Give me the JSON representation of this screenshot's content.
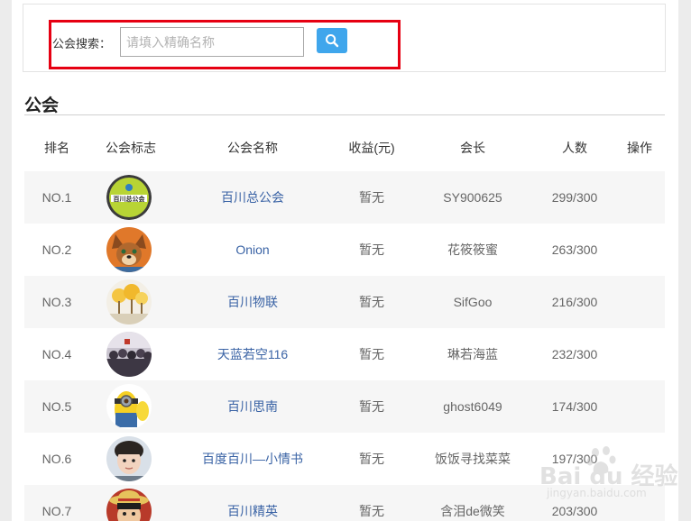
{
  "search": {
    "label": "公会搜索：",
    "placeholder": "请填入精确名称",
    "button_icon": "search-icon"
  },
  "section": {
    "title": "公会"
  },
  "table": {
    "headers": [
      "排名",
      "公会标志",
      "公会名称",
      "收益(元)",
      "会长",
      "人数",
      "操作"
    ],
    "rows": [
      {
        "rank": "NO.1",
        "logo": "guild-logo-bc",
        "logo_text": "百川总公会",
        "name": "百川总公会",
        "income": "暂无",
        "leader": "SY900625",
        "members": "299/300"
      },
      {
        "rank": "NO.2",
        "logo": "guild-logo-fox",
        "name": "Onion",
        "income": "暂无",
        "leader": "花筱筱蜜",
        "members": "263/300"
      },
      {
        "rank": "NO.3",
        "logo": "guild-logo-trees",
        "name": "百川物联",
        "income": "暂无",
        "leader": "SifGoo",
        "members": "216/300"
      },
      {
        "rank": "NO.4",
        "logo": "guild-logo-crowd",
        "name": "天蓝若空116",
        "income": "暂无",
        "leader": "琳若海蓝",
        "members": "232/300"
      },
      {
        "rank": "NO.5",
        "logo": "guild-logo-minion",
        "name": "百川思南",
        "income": "暂无",
        "leader": "ghost6049",
        "members": "174/300"
      },
      {
        "rank": "NO.6",
        "logo": "guild-logo-child",
        "name": "百度百川—小情书",
        "income": "暂无",
        "leader": "饭饭寻找菜菜",
        "members": "197/300"
      },
      {
        "rank": "NO.7",
        "logo": "guild-logo-luffy",
        "name": "百川精英",
        "income": "暂无",
        "leader": "含泪de微笑",
        "members": "203/300"
      }
    ]
  },
  "watermark": {
    "brand": "Bai du 经验",
    "sub": "jingyan.baidu.com"
  },
  "colors": {
    "accent": "#3fa6ec",
    "highlight": "#e60012",
    "link": "#3a63a5",
    "row_shade": "#f6f6f6"
  }
}
